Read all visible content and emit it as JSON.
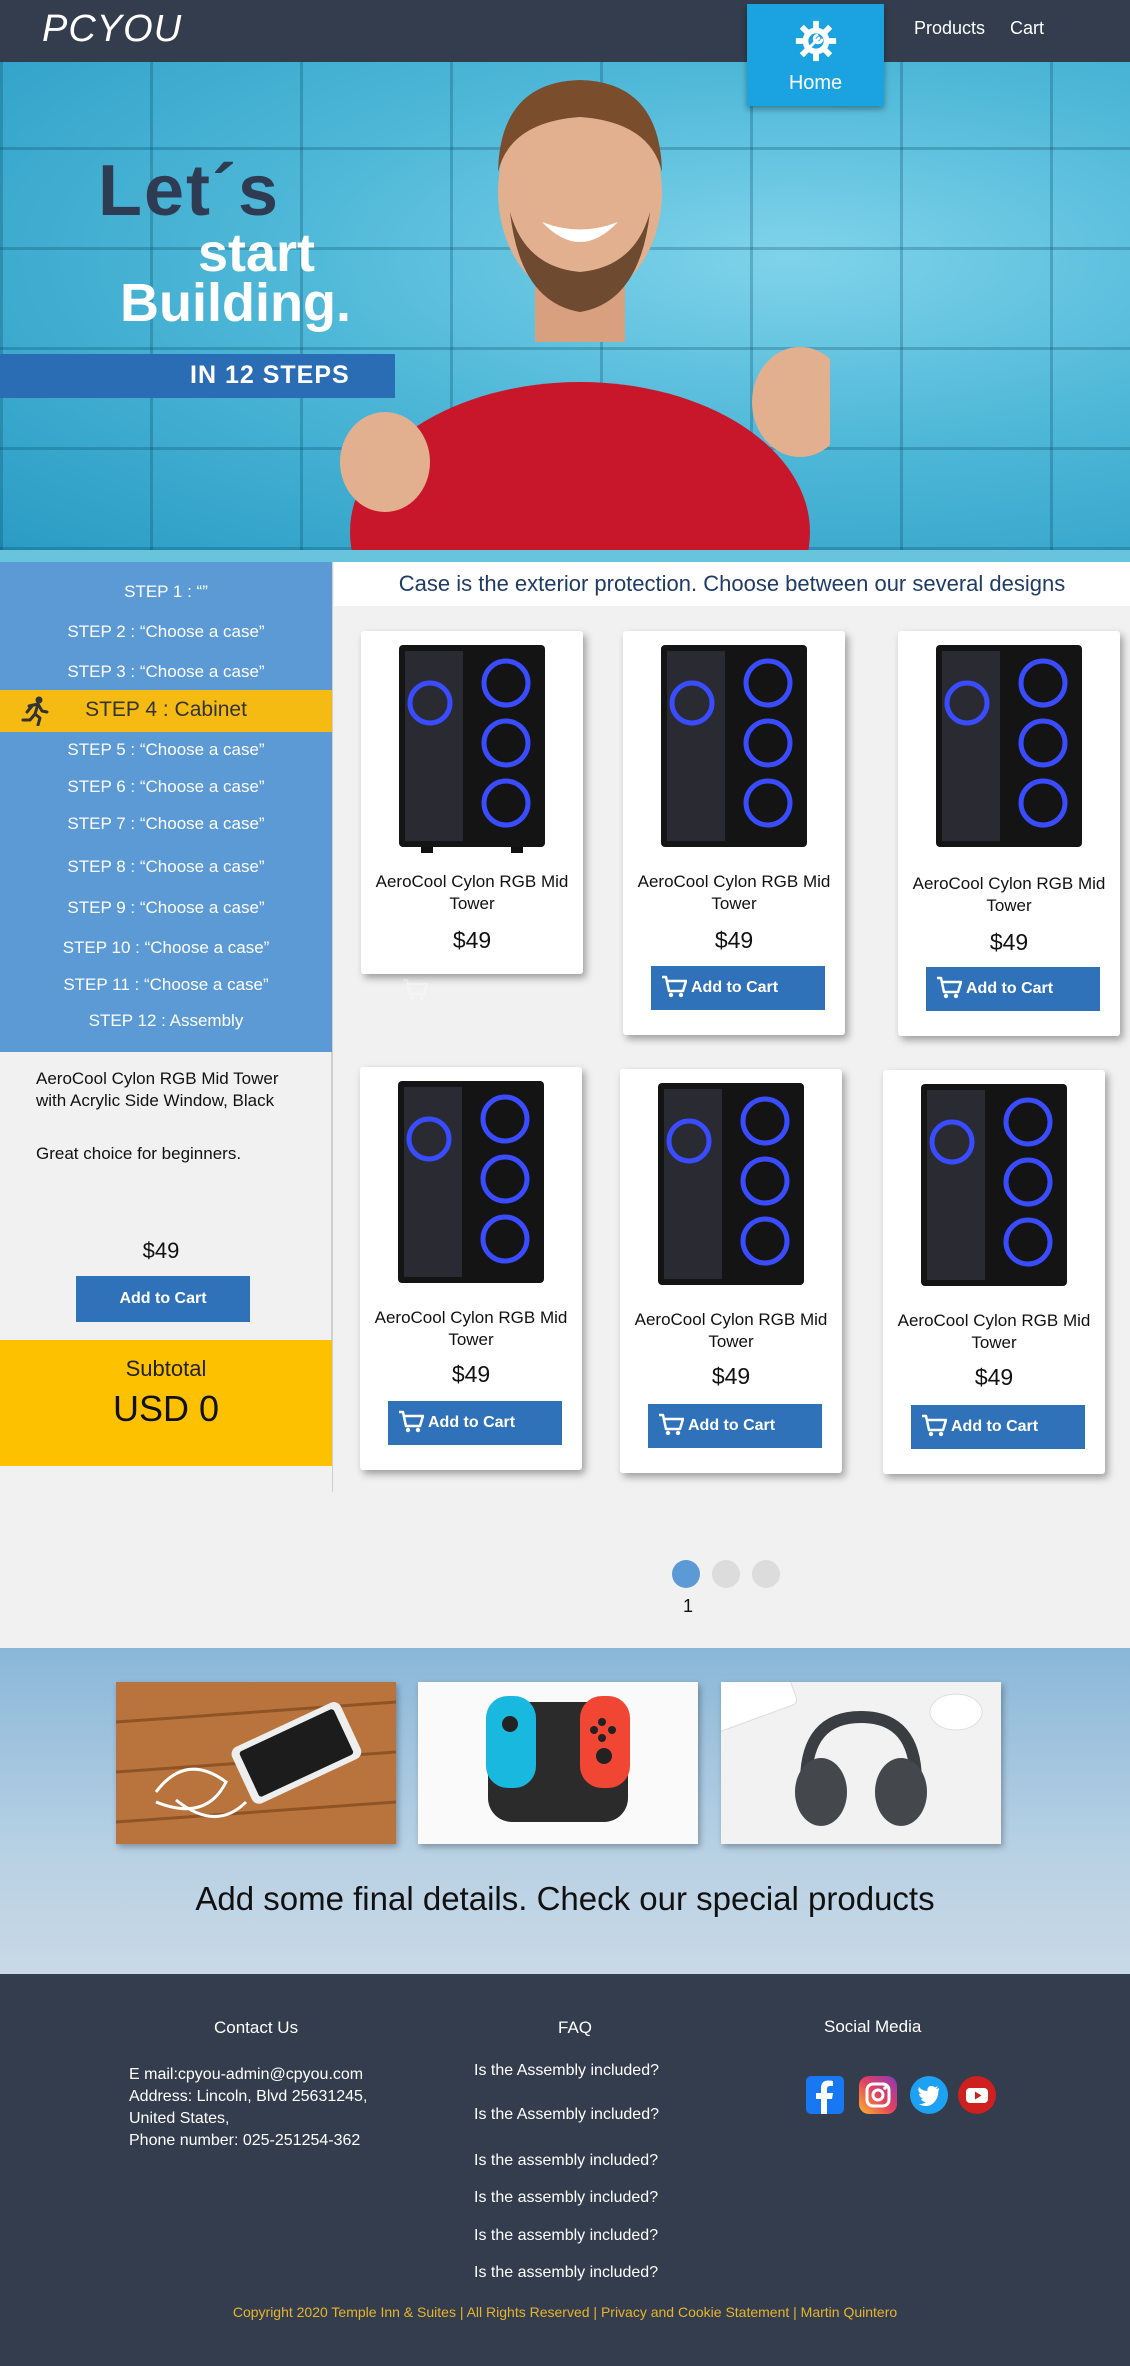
{
  "nav": {
    "logo": "PCYOU",
    "home_label": "Home",
    "products_label": "Products",
    "cart_label": "Cart"
  },
  "hero": {
    "line1": "Let´s",
    "line2": "start",
    "line3": "Building.",
    "band": "IN 12 STEPS"
  },
  "steps": [
    "STEP 1 : “”",
    "STEP 2 : “Choose a case”",
    "STEP 3 : “Choose a case”",
    "STEP 4 : Cabinet",
    "STEP 5 : “Choose a case”",
    "STEP 6 : “Choose a case”",
    "STEP 7 : “Choose a case”",
    "STEP 8 : “Choose a case”",
    "STEP 9 : “Choose a case”",
    "STEP 10 : “Choose a case”",
    "STEP 11 : “Choose a case”",
    "STEP 12 : Assembly"
  ],
  "detail": {
    "name": "AeroCool Cylon RGB Mid Tower with Acrylic Side Window, Black",
    "note": "Great choice for beginners.",
    "price": "$49",
    "button": "Add to Cart"
  },
  "subtotal": {
    "label": "Subtotal",
    "value": "USD 0"
  },
  "case_title": "Case is the exterior protection. Choose between our several designs",
  "products": [
    {
      "name": "AeroCool Cylon RGB Mid Tower",
      "price": "$49",
      "button": ""
    },
    {
      "name": "AeroCool Cylon RGB Mid Tower",
      "price": "$49",
      "button": "Add to Cart"
    },
    {
      "name": "AeroCool Cylon RGB Mid Tower",
      "price": "$49",
      "button": "Add to Cart"
    },
    {
      "name": "AeroCool Cylon RGB Mid Tower",
      "price": "$49",
      "button": "Add to Cart"
    },
    {
      "name": "AeroCool Cylon RGB Mid Tower",
      "price": "$49",
      "button": "Add to Cart"
    },
    {
      "name": "AeroCool Cylon RGB Mid Tower",
      "price": "$49",
      "button": "Add to Cart"
    }
  ],
  "pagination": {
    "current": "1"
  },
  "special": {
    "title": "Add some final details. Check our special products"
  },
  "footer": {
    "contact_title": "Contact Us",
    "email": "E mail:cpyou-admin@cpyou.com",
    "address1": "Address: Lincoln, Blvd 25631245,",
    "address2": "United States,",
    "phone": "Phone number: 025-251254-362",
    "faq_title": "FAQ",
    "faq": [
      "Is the Assembly  included?",
      "Is the Assembly  included?",
      "Is the assembly  included?",
      "Is the assembly  included?",
      "Is the assembly  included?",
      "Is the assembly  included?"
    ],
    "social_title": "Social Media",
    "copyright": "Copyright 2020 Temple Inn & Suites | All Rights Reserved | Privacy and Cookie Statement | Martin Quintero"
  },
  "colors": {
    "nav": "#333d4e",
    "accent_blue": "#1aa3e0",
    "sidebar": "#5c9ad6",
    "active_step": "#f6bb12",
    "button": "#2f72ba",
    "subtotal": "#fdc100"
  }
}
